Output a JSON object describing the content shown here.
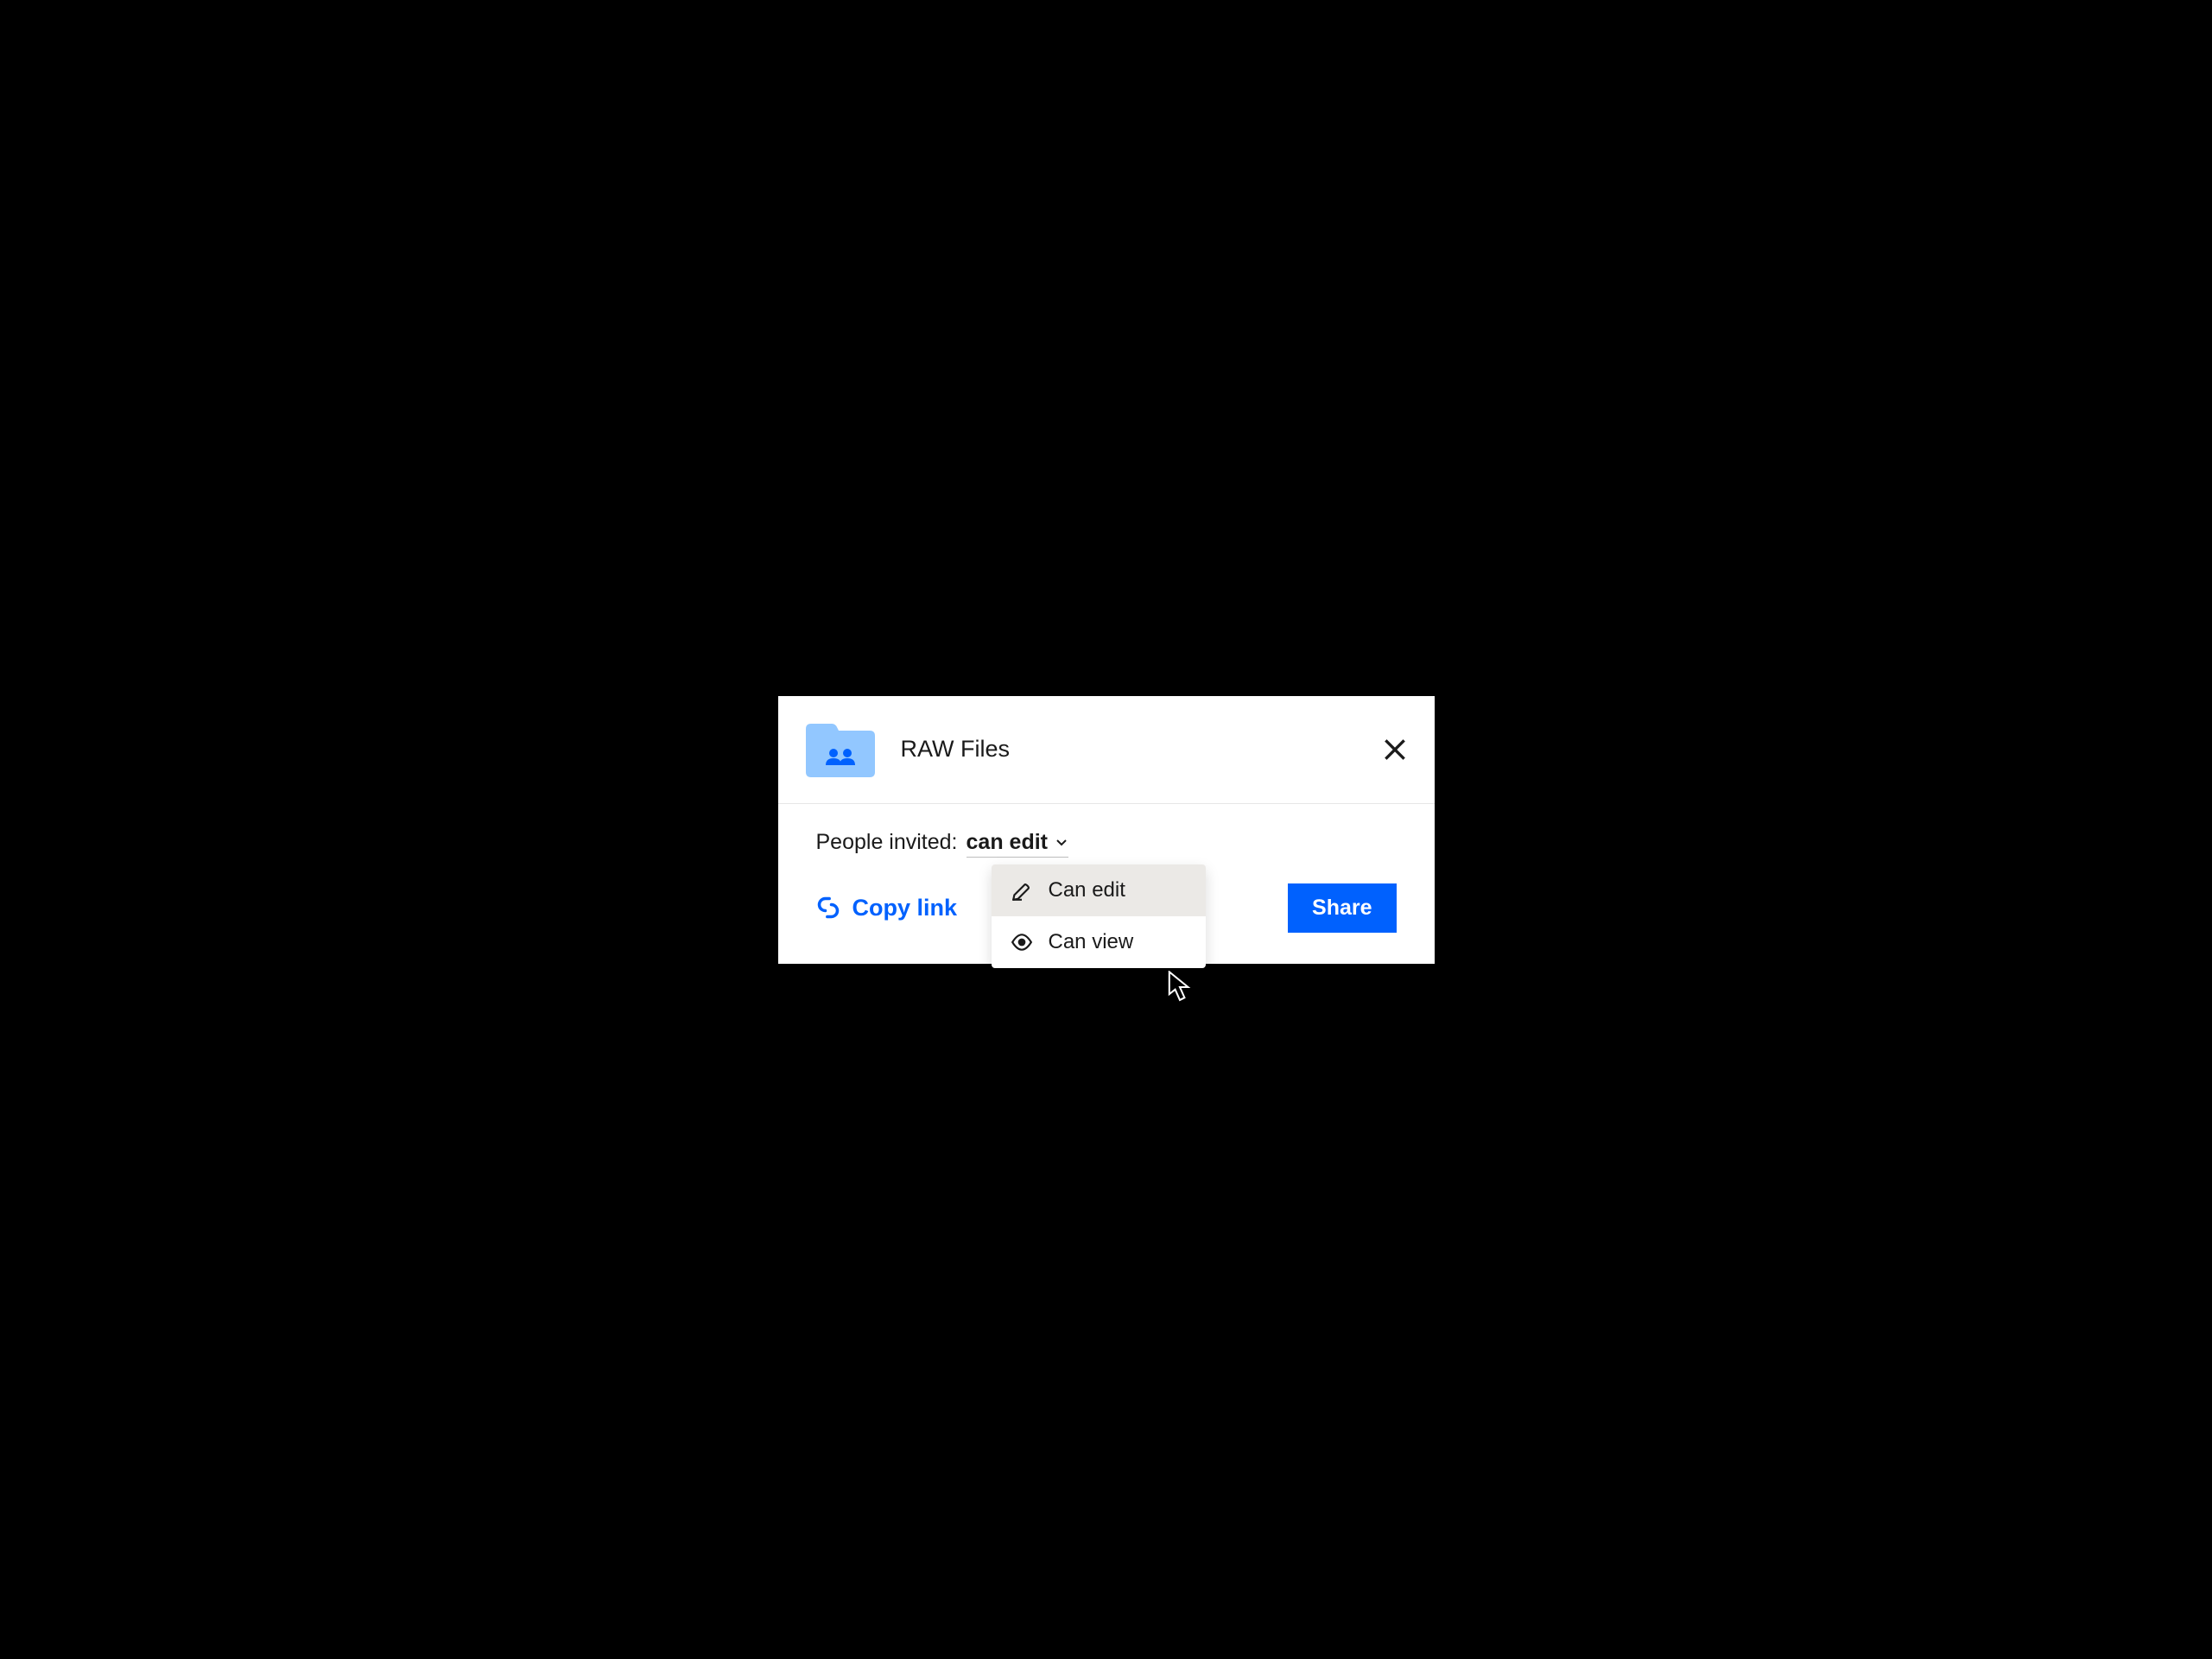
{
  "header": {
    "folder_name": "RAW Files"
  },
  "body": {
    "people_invited_label": "People invited:",
    "permission_selected": "can edit"
  },
  "dropdown": {
    "options": [
      {
        "label": "Can edit"
      },
      {
        "label": "Can view"
      }
    ]
  },
  "footer": {
    "copy_link_label": "Copy link",
    "share_label": "Share"
  },
  "colors": {
    "accent": "#0061fe",
    "folder": "#92c7ff"
  }
}
